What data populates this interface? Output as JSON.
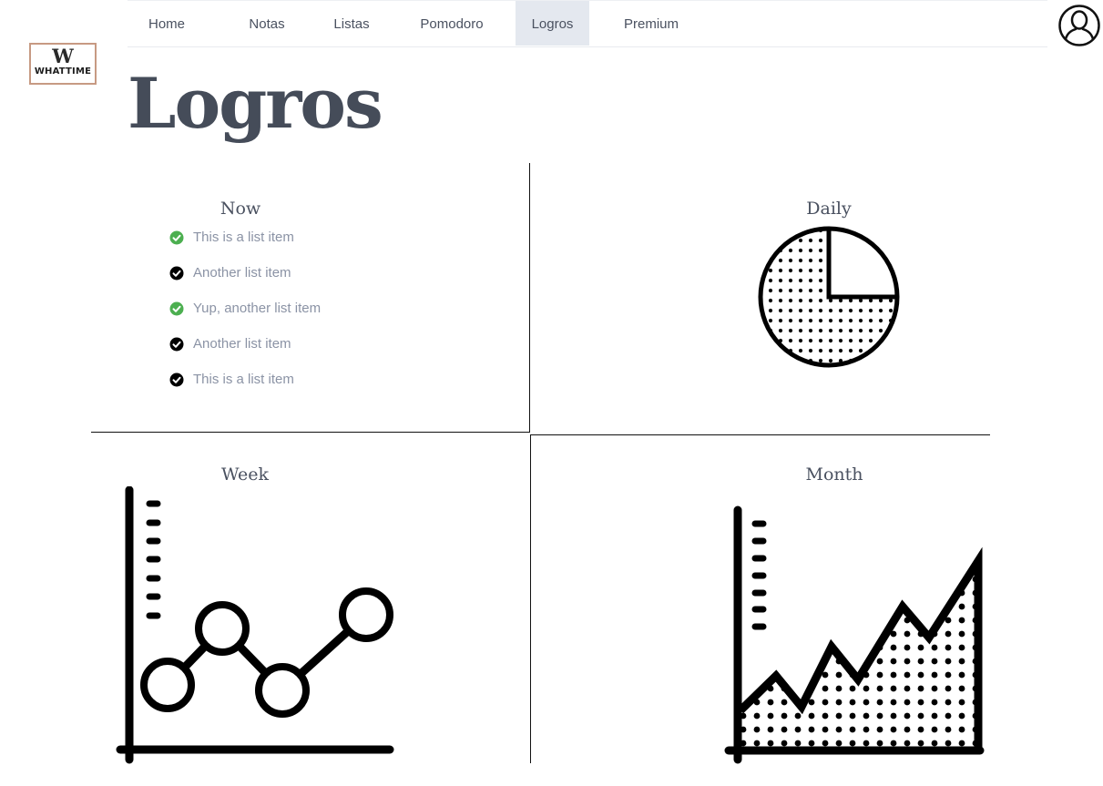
{
  "nav": {
    "items": [
      {
        "label": "Home"
      },
      {
        "label": "Notas"
      },
      {
        "label": "Listas"
      },
      {
        "label": "Pomodoro"
      },
      {
        "label": "Logros",
        "active": true
      },
      {
        "label": "Premium"
      }
    ]
  },
  "logo": {
    "mark": "W",
    "text": "WHATTIME"
  },
  "page": {
    "title": "Logros"
  },
  "sections": {
    "now": {
      "title": "Now",
      "items": [
        {
          "label": "This is a list item",
          "status": "done",
          "icon": "check-circle-icon"
        },
        {
          "label": "Another list item",
          "status": "pending",
          "icon": "check-circle-icon"
        },
        {
          "label": "Yup, another list item",
          "status": "done",
          "icon": "check-circle-icon"
        },
        {
          "label": "Another list item",
          "status": "pending",
          "icon": "check-circle-icon"
        },
        {
          "label": "This is a list item",
          "status": "pending",
          "icon": "check-circle-icon"
        }
      ]
    },
    "daily": {
      "title": "Daily",
      "icon": "pie-chart-icon"
    },
    "week": {
      "title": "Week",
      "icon": "line-chart-icon"
    },
    "month": {
      "title": "Month",
      "icon": "area-chart-icon"
    }
  },
  "colors": {
    "done": "#4caf50",
    "pending": "#000000",
    "title": "#454c59",
    "nav_active_bg": "#e4e8ef",
    "logo_border": "#c79a83"
  }
}
